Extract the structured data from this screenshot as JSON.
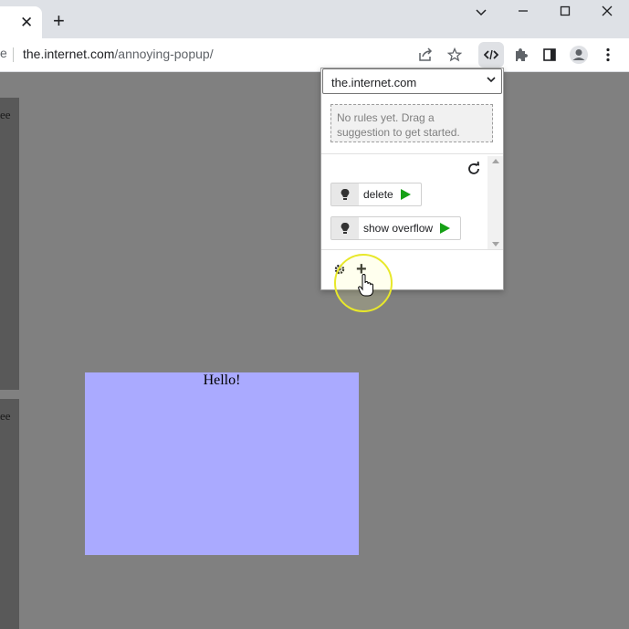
{
  "browser": {
    "tab": {
      "close_glyph": "✕"
    },
    "new_tab_glyph": "+",
    "window_controls": {
      "dropdown": "⌄",
      "minimize": "—",
      "maximize": "☐",
      "close": "✕"
    },
    "omnibox": {
      "prefix_fragment": "e",
      "url_host": "the.internet.com",
      "url_path": "/annoying-popup/"
    },
    "toolbar_icons": [
      "share-icon",
      "star-icon",
      "extension-code-icon",
      "puzzle-icon",
      "side-panel-icon",
      "profile-icon",
      "kebab-menu-icon"
    ]
  },
  "page": {
    "side_text_1": "ee",
    "side_text_2": "ee",
    "hello": "Hello!",
    "hello_box_color": "#aaaaff",
    "background_color": "#808080"
  },
  "popup": {
    "site_select_value": "the.internet.com",
    "empty_rules_text": "No rules yet. Drag a suggestion to get started.",
    "suggestions": [
      {
        "label": "delete",
        "icon": "lightbulb-icon",
        "action_icon": "play-icon"
      },
      {
        "label": "show overflow",
        "icon": "lightbulb-icon",
        "action_icon": "play-icon"
      }
    ],
    "footer": {
      "settings_icon": "gear-icon",
      "add_glyph": "+"
    },
    "play_color": "#16a016"
  }
}
